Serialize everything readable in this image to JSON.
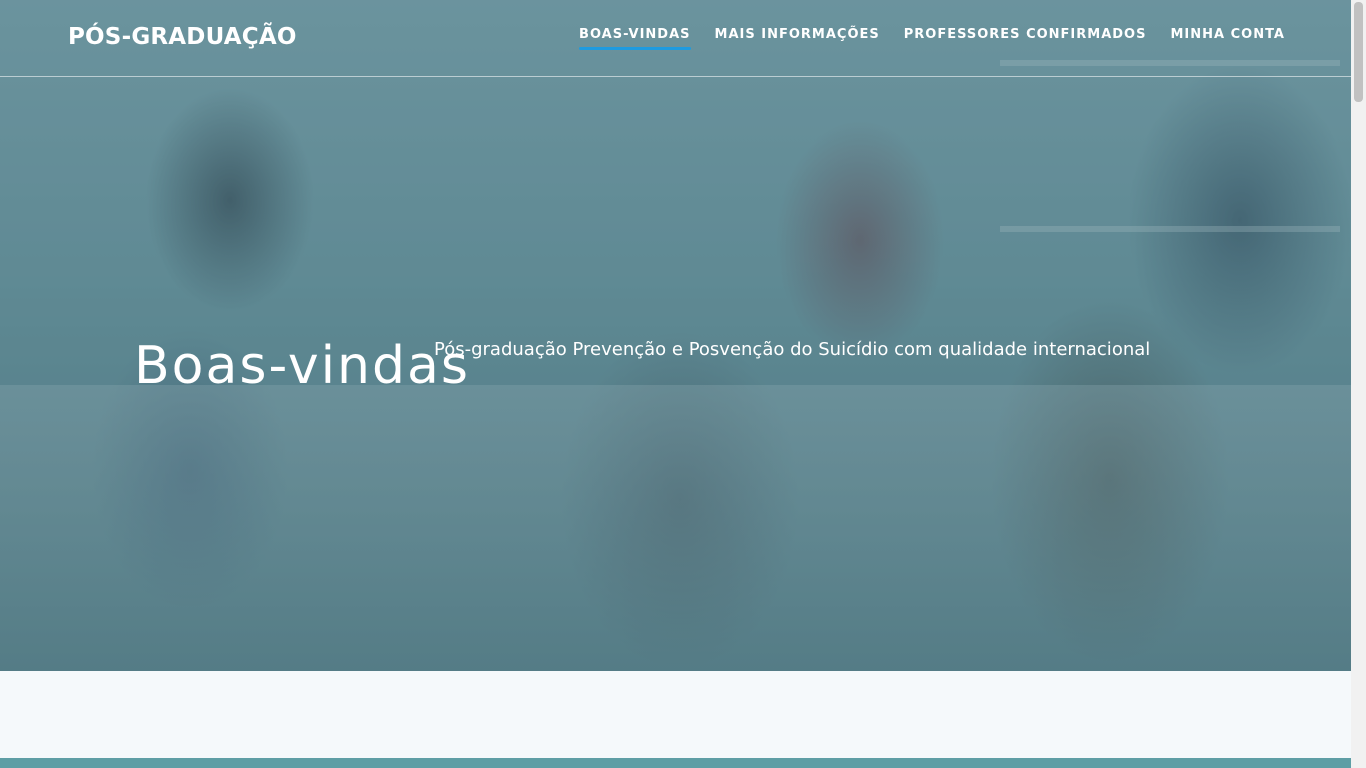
{
  "brand": "PÓS-GRADUAÇÃO",
  "nav": {
    "items": [
      "BOAS-VINDAS",
      "MAIS INFORMAÇÕES",
      "PROFESSORES CONFIRMADOS",
      "MINHA CONTA"
    ],
    "active_index": 0,
    "active_color": "#1e9be0"
  },
  "hero": {
    "title": "Boas-vindas",
    "subtitle": "Pós-graduação Prevenção e Posvenção do Suicídio com qualidade internacional"
  },
  "colors": {
    "overlay": "#285f6e",
    "footer_strip": "#5e9ea5",
    "page_background": "#f5f9fb"
  }
}
